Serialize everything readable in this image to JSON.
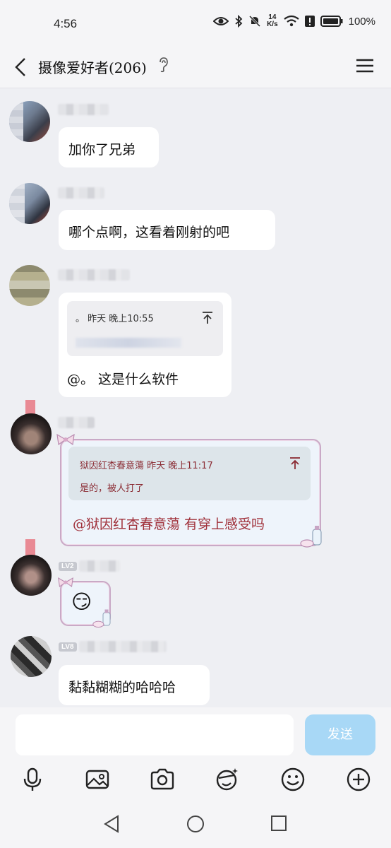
{
  "status": {
    "time": "4:56",
    "net_speed_top": "14",
    "net_speed_bottom": "K/s",
    "battery": "100%"
  },
  "header": {
    "title": "摄像爱好者(206)"
  },
  "messages": [
    {
      "text": "加你了兄弟"
    },
    {
      "text": "哪个点啊，这看着刚射的吧"
    },
    {
      "quote_time": "。 昨天 晚上10:55",
      "text": "@。 这是什么软件"
    },
    {
      "quote_time": "狱因红杏春意蕩 昨天 晚上11:17",
      "quote_text": "是的，被人打了",
      "text": "@狱因红杏春意蕩 有穿上感受吗"
    },
    {
      "level": "LV2",
      "emoji": "😏"
    },
    {
      "level": "LV8",
      "text": "黏黏糊糊的哈哈哈"
    }
  ],
  "composer": {
    "send_label": "发送",
    "input_value": ""
  },
  "colors": {
    "accent": "#a8d8f6",
    "quote_red": "#a0303a"
  }
}
